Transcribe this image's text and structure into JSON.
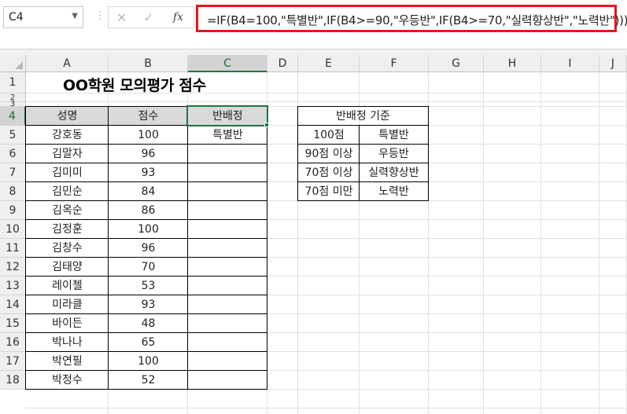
{
  "formula_bar": {
    "name_box": "C4",
    "formula": "=IF(B4=100,\"특별반\",IF(B4>=90,\"우등반\",IF(B4>=70,\"실력향상반\",\"노력반\")))"
  },
  "columns": [
    "A",
    "B",
    "C",
    "D",
    "E",
    "F",
    "G",
    "H",
    "I",
    "J"
  ],
  "rows": [
    "1",
    "2",
    "3",
    "4",
    "5",
    "6",
    "7",
    "8",
    "9",
    "10",
    "11",
    "12",
    "13",
    "14",
    "15",
    "16",
    "17",
    "18"
  ],
  "sheet": {
    "title": "OO학원 모의평가 점수",
    "headers": [
      "성명",
      "점수",
      "반배정"
    ],
    "students": [
      {
        "name": "강호동",
        "score": "100",
        "class": "특별반"
      },
      {
        "name": "김말자",
        "score": "96",
        "class": ""
      },
      {
        "name": "김미미",
        "score": "93",
        "class": ""
      },
      {
        "name": "김민순",
        "score": "84",
        "class": ""
      },
      {
        "name": "김옥순",
        "score": "86",
        "class": ""
      },
      {
        "name": "김정훈",
        "score": "100",
        "class": ""
      },
      {
        "name": "김창수",
        "score": "96",
        "class": ""
      },
      {
        "name": "김태양",
        "score": "70",
        "class": ""
      },
      {
        "name": "레이첼",
        "score": "53",
        "class": ""
      },
      {
        "name": "미라클",
        "score": "93",
        "class": ""
      },
      {
        "name": "바이든",
        "score": "48",
        "class": ""
      },
      {
        "name": "박나나",
        "score": "65",
        "class": ""
      },
      {
        "name": "박연필",
        "score": "100",
        "class": ""
      },
      {
        "name": "박정수",
        "score": "52",
        "class": ""
      }
    ],
    "criteria": {
      "title": "반배정 기준",
      "rows": [
        {
          "condition": "100점",
          "class": "특별반"
        },
        {
          "condition": "90점 이상",
          "class": "우등반"
        },
        {
          "condition": "70점 이상",
          "class": "실력향상반"
        },
        {
          "condition": "70점 미만",
          "class": "노력반"
        }
      ]
    }
  }
}
